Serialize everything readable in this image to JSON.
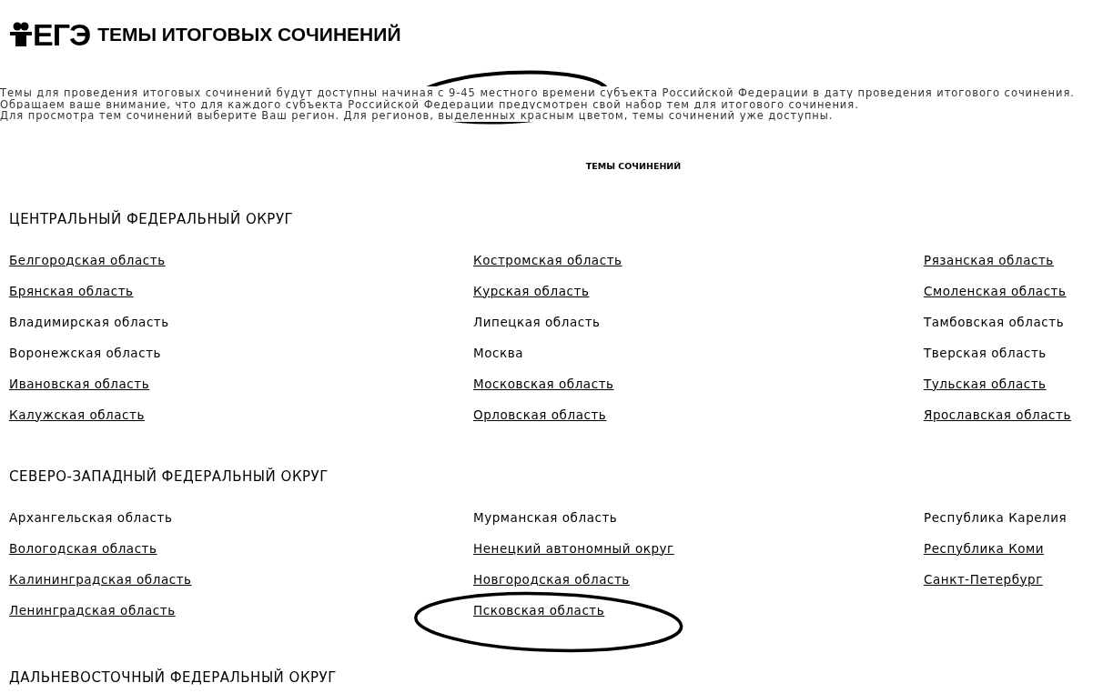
{
  "header": {
    "logo_text": "ЕГЭ",
    "title": "ТЕМЫ ИТОГОВЫХ СОЧИНЕНИЙ"
  },
  "intro": [
    "Темы для проведения итоговых сочинений будут доступны начиная с 9-45 местного времени субъекта Российской Федерации в дату проведения итогового сочинения.",
    "Обращаем ваше внимание, что для каждого субъекта Российской Федерации предусмотрен свой набор тем для итогового сочинения.",
    "Для просмотра тем сочинений выберите Ваш регион. Для регионов, выделенных красным цветом, темы сочинений уже доступны."
  ],
  "subheading": "ТЕМЫ СОЧИНЕНИЙ",
  "districts": [
    {
      "name": "ЦЕНТРАЛЬНЫЙ ФЕДЕРАЛЬНЫЙ ОКРУГ",
      "columns": [
        [
          {
            "name": "Белгородская область",
            "available": true
          },
          {
            "name": "Брянская область",
            "available": true
          },
          {
            "name": "Владимирская область",
            "available": false
          },
          {
            "name": "Воронежская область",
            "available": false
          },
          {
            "name": "Ивановская область",
            "available": true
          },
          {
            "name": "Калужская область",
            "available": true
          }
        ],
        [
          {
            "name": "Костромская область",
            "available": true
          },
          {
            "name": "Курская область",
            "available": true
          },
          {
            "name": "Липецкая область",
            "available": false
          },
          {
            "name": "Москва",
            "available": false
          },
          {
            "name": "Московская область",
            "available": true
          },
          {
            "name": "Орловская область",
            "available": true
          }
        ],
        [
          {
            "name": "Рязанская область",
            "available": true
          },
          {
            "name": "Смоленская область",
            "available": true
          },
          {
            "name": "Тамбовская область",
            "available": false
          },
          {
            "name": "Тверская область",
            "available": false
          },
          {
            "name": "Тульская область",
            "available": true
          },
          {
            "name": "Ярославская область",
            "available": true
          }
        ]
      ]
    },
    {
      "name": "СЕВЕРО-ЗАПАДНЫЙ ФЕДЕРАЛЬНЫЙ ОКРУГ",
      "columns": [
        [
          {
            "name": "Архангельская область",
            "available": false
          },
          {
            "name": "Вологодская область",
            "available": true
          },
          {
            "name": "Калининградская область",
            "available": true
          },
          {
            "name": "Ленинградская область",
            "available": true
          }
        ],
        [
          {
            "name": "Мурманская область",
            "available": false
          },
          {
            "name": "Ненецкий автономный округ",
            "available": true
          },
          {
            "name": "Новгородская область",
            "available": true
          },
          {
            "name": "Псковская область",
            "available": true
          }
        ],
        [
          {
            "name": "Республика Карелия",
            "available": false
          },
          {
            "name": "Республика Коми",
            "available": true
          },
          {
            "name": "Санкт-Петербург",
            "available": true
          }
        ]
      ]
    },
    {
      "name": "ДАЛЬНЕВОСТОЧНЫЙ ФЕДЕРАЛЬНЫЙ ОКРУГ"
    }
  ]
}
